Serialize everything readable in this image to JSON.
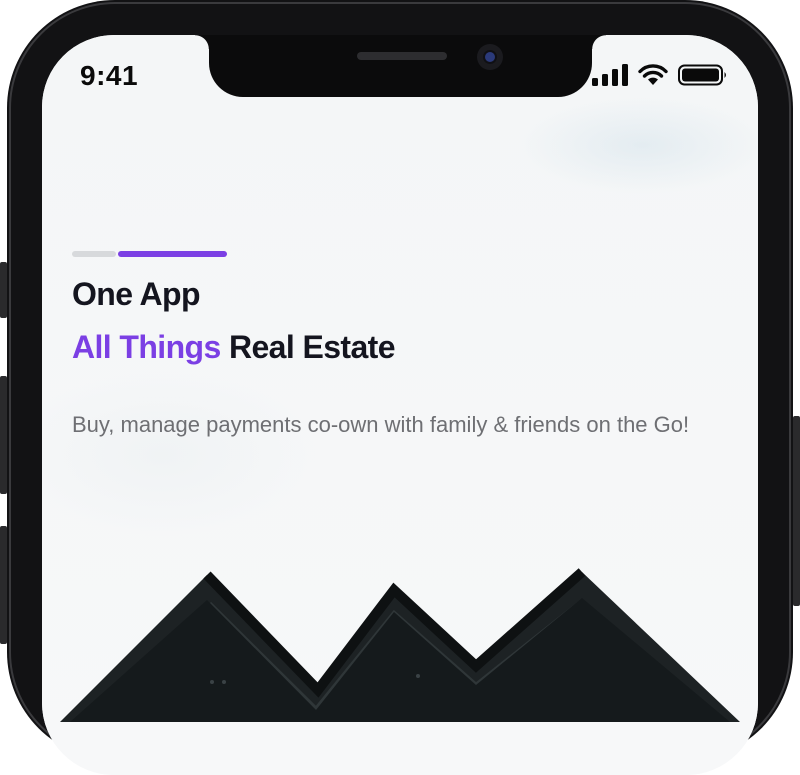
{
  "status_bar": {
    "time": "9:41",
    "icons": [
      "cellular-signal-icon",
      "wifi-icon",
      "battery-icon"
    ]
  },
  "onboarding": {
    "progress": {
      "total_steps": 2,
      "current_step": 2
    },
    "title_line1": "One App",
    "title_line2_accent": "All Things",
    "title_line2_rest": "Real Estate",
    "description": "Buy, manage payments co-own with family & friends on the Go!"
  },
  "colors": {
    "accent": "#7b3fe4",
    "title": "#14151f",
    "body_text": "#6e6f73",
    "inactive_step": "#d7d9dc"
  }
}
